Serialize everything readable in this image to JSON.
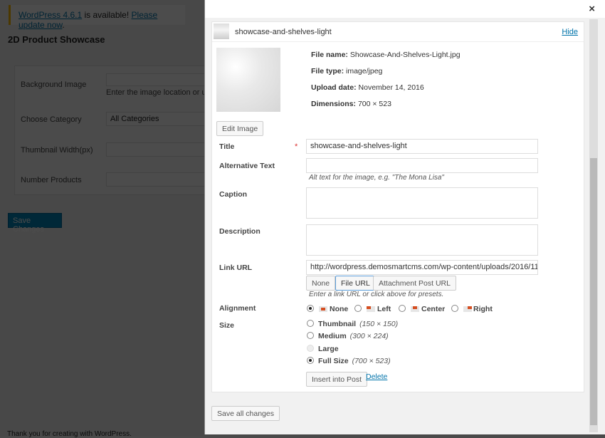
{
  "background": {
    "notice": {
      "version_link": "WordPress 4.6.1",
      "text": " is available! ",
      "update_link": "Please update now",
      "end": "."
    },
    "page_title": "2D Product Showcase",
    "fields": [
      {
        "label": "Background Image",
        "value": "",
        "help": "Enter the image location or up"
      },
      {
        "label": "Choose Category",
        "value": "All Categories"
      },
      {
        "label": "Thumbnail Width(px)",
        "value": ""
      },
      {
        "label": "Number Products",
        "value": ""
      }
    ],
    "save_label": "Save Changes",
    "footer": "Thank you for creating with WordPress."
  },
  "modal": {
    "close_icon": "×",
    "attachment_title": "showcase-and-shelves-light",
    "hide_label": "Hide",
    "meta": [
      {
        "label": "File name:",
        "value": "Showcase-And-Shelves-Light.jpg"
      },
      {
        "label": "File type:",
        "value": "image/jpeg"
      },
      {
        "label": "Upload date:",
        "value": "November 14, 2016"
      },
      {
        "label": "Dimensions:",
        "value": "700 × 523"
      }
    ],
    "edit_image_label": "Edit Image",
    "title_label": "Title",
    "required_mark": "*",
    "title_value": "showcase-and-shelves-light",
    "alt_label": "Alternative Text",
    "alt_value": "",
    "alt_hint": "Alt text for the image, e.g. \"The Mona Lisa\"",
    "caption_label": "Caption",
    "caption_value": "",
    "description_label": "Description",
    "description_value": "",
    "link_label": "Link URL",
    "link_value": "http://wordpress.demosmartcms.com/wp-content/uploads/2016/11/",
    "link_buttons": [
      "None",
      "File URL",
      "Attachment Post URL"
    ],
    "link_hint": "Enter a link URL or click above for presets.",
    "alignment_label": "Alignment",
    "alignment_options": [
      "None",
      "Left",
      "Center",
      "Right"
    ],
    "alignment_selected": "None",
    "size_label": "Size",
    "sizes": [
      {
        "label": "Thumbnail",
        "dims": "(150 × 150)"
      },
      {
        "label": "Medium",
        "dims": "(300 × 224)"
      },
      {
        "label": "Large",
        "dims": ""
      },
      {
        "label": "Full Size",
        "dims": "(700 × 523)"
      }
    ],
    "size_selected": "Full Size",
    "insert_label": "Insert into Post",
    "delete_label": "Delete",
    "save_all_label": "Save all changes"
  }
}
